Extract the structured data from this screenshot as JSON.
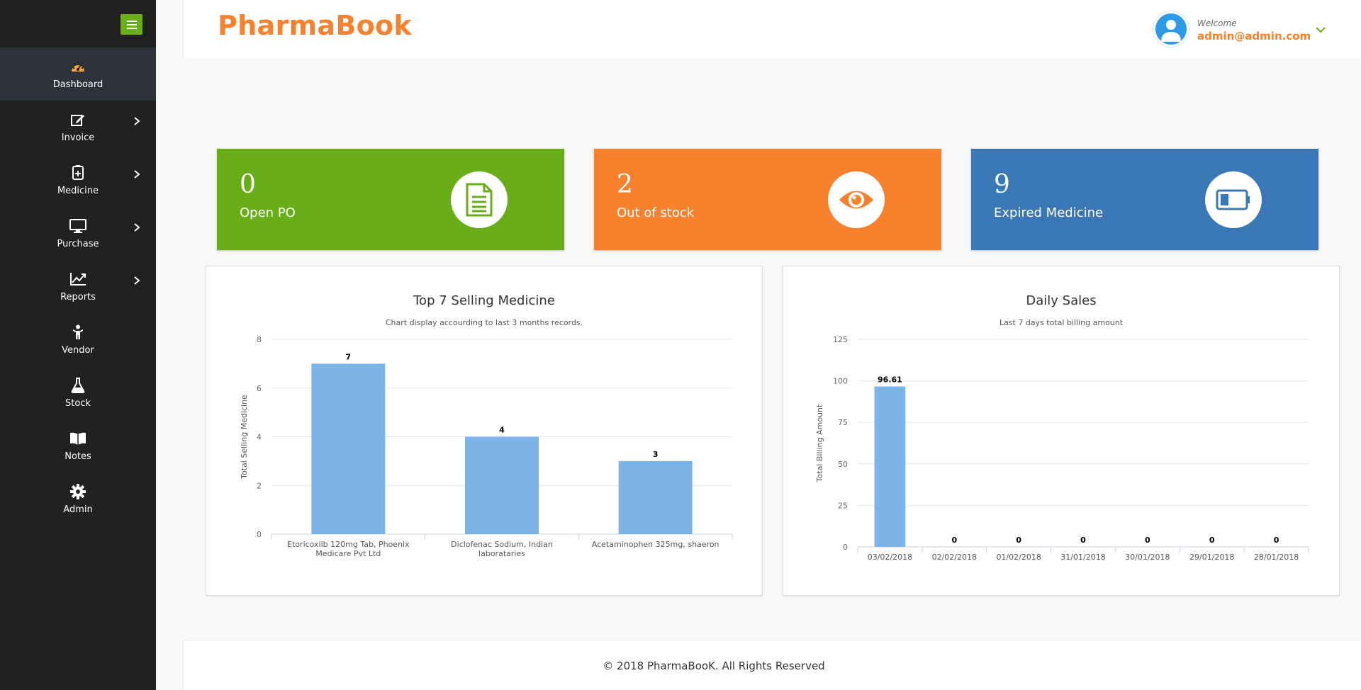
{
  "app": {
    "brand": "PharmaBook"
  },
  "user": {
    "welcome": "Welcome",
    "email": "admin@admin.com"
  },
  "sidebar": {
    "items": [
      {
        "label": "Dashboard",
        "icon": "dashboard-icon",
        "active": true,
        "submenu": false
      },
      {
        "label": "Invoice",
        "icon": "edit-icon",
        "active": false,
        "submenu": true
      },
      {
        "label": "Medicine",
        "icon": "medicine-bottle-icon",
        "active": false,
        "submenu": true
      },
      {
        "label": "Purchase",
        "icon": "monitor-icon",
        "active": false,
        "submenu": true
      },
      {
        "label": "Reports",
        "icon": "line-chart-icon",
        "active": false,
        "submenu": true
      },
      {
        "label": "Vendor",
        "icon": "person-icon",
        "active": false,
        "submenu": false
      },
      {
        "label": "Stock",
        "icon": "flask-icon",
        "active": false,
        "submenu": false
      },
      {
        "label": "Notes",
        "icon": "book-icon",
        "active": false,
        "submenu": false
      },
      {
        "label": "Admin",
        "icon": "gear-icon",
        "active": false,
        "submenu": false
      }
    ]
  },
  "stats": [
    {
      "value": "0",
      "label": "Open PO",
      "color": "#69ae18",
      "icon": "document-icon"
    },
    {
      "value": "2",
      "label": "Out of stock",
      "color": "#f7812c",
      "icon": "eye-icon"
    },
    {
      "value": "9",
      "label": "Expired Medicine",
      "color": "#3a78b5",
      "icon": "battery-icon"
    }
  ],
  "chart_data": [
    {
      "type": "bar",
      "title": "Top 7 Selling Medicine",
      "subtitle": "Chart display accourding to last 3 months records.",
      "ylabel": "Total Selling Medicine",
      "categories": [
        "Etoricoxilb 120mg Tab, Phoenix Medicare Pvt Ltd",
        "Diclofenac Sodium, Indian laborataries",
        "Acetaminophen 325mg, shaeron"
      ],
      "values": [
        7,
        4,
        3
      ],
      "data_labels": [
        "7",
        "4",
        "3"
      ],
      "ylim": [
        0,
        8
      ],
      "yticks": [
        "0",
        "2",
        "4",
        "6",
        "8"
      ],
      "grid": true,
      "bar_color": "#7db4e8"
    },
    {
      "type": "bar",
      "title": "Daily Sales",
      "subtitle": "Last 7 days total billing amount",
      "ylabel": "Total Billing Amount",
      "categories": [
        "03/02/2018",
        "02/02/2018",
        "01/02/2018",
        "31/01/2018",
        "30/01/2018",
        "29/01/2018",
        "28/01/2018"
      ],
      "values": [
        96.61,
        0,
        0,
        0,
        0,
        0,
        0
      ],
      "data_labels": [
        "96.61",
        "0",
        "0",
        "0",
        "0",
        "0",
        "0"
      ],
      "ylim": [
        0,
        125
      ],
      "yticks": [
        "0",
        "25",
        "50",
        "75",
        "100",
        "125"
      ],
      "grid": true,
      "bar_color": "#7db4e8"
    }
  ],
  "footer": {
    "text": "© 2018 PharmaBooK. All Rights Reserved"
  }
}
